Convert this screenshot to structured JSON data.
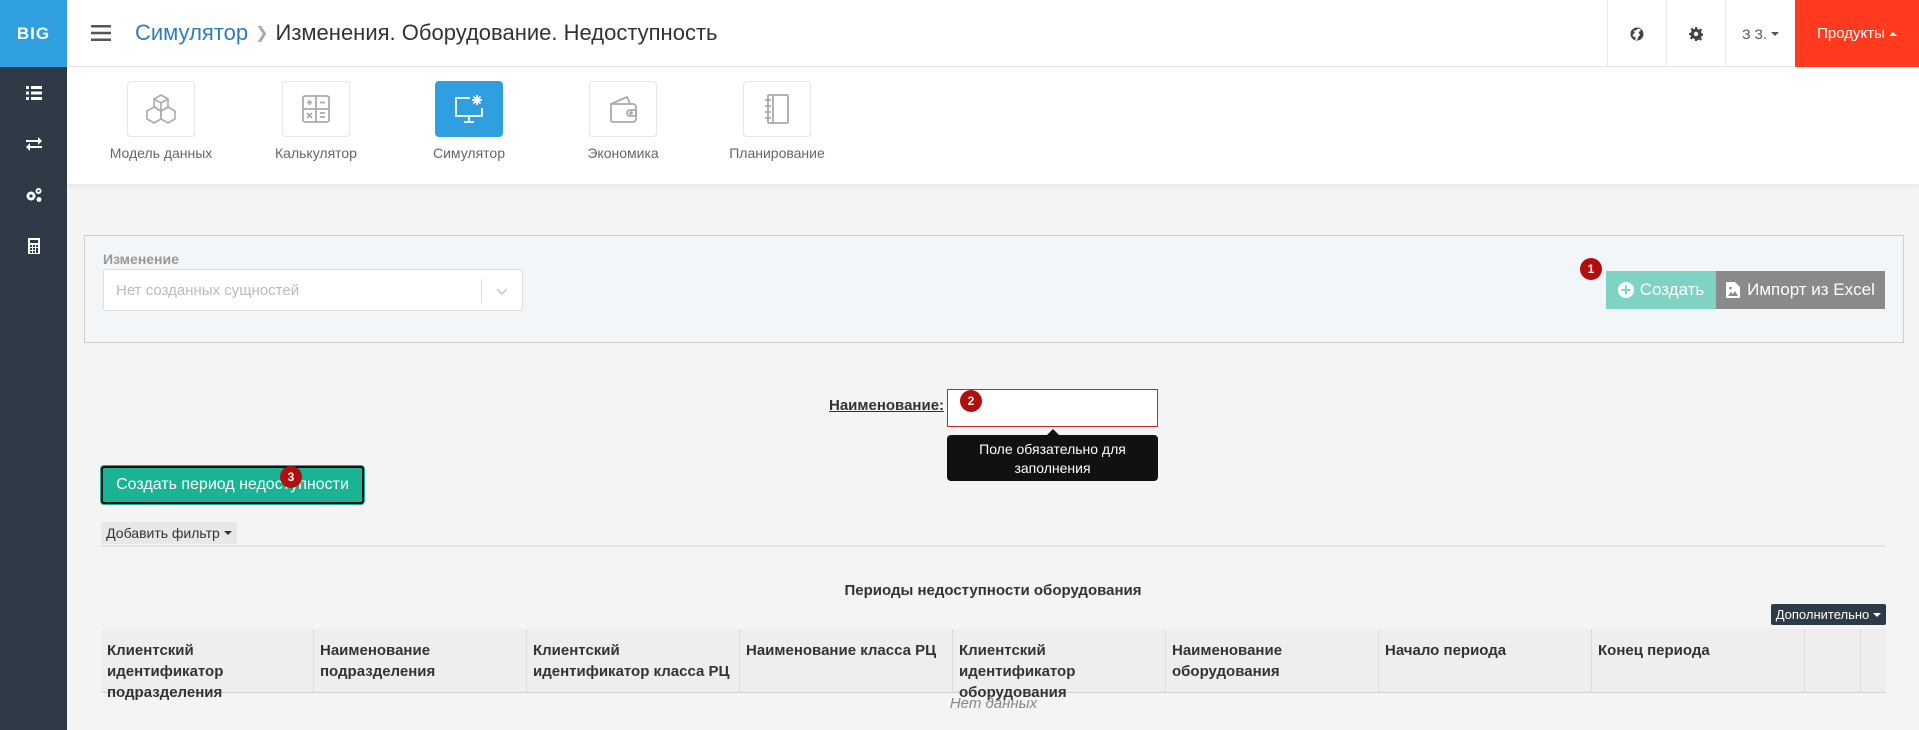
{
  "sidebar": {
    "logo": "BIG",
    "items": [
      {
        "icon": "list-icon"
      },
      {
        "icon": "exchange-icon"
      },
      {
        "icon": "cogs-icon"
      },
      {
        "icon": "calculator-icon"
      }
    ]
  },
  "header": {
    "breadcrumb_link": "Симулятор",
    "breadcrumb_current": "Изменения. Оборудование. Недоступность",
    "user_label": "З З.",
    "products_label": "Продукты"
  },
  "modules": [
    {
      "label": "Модель данных",
      "icon": "cubes-icon"
    },
    {
      "label": "Калькулятор",
      "icon": "calculator-icon"
    },
    {
      "label": "Симулятор",
      "icon": "monitor-icon",
      "active": true
    },
    {
      "label": "Экономика",
      "icon": "wallet-icon"
    },
    {
      "label": "Планирование",
      "icon": "notebook-icon"
    }
  ],
  "panel": {
    "label": "Изменение",
    "select_placeholder": "Нет созданных сущностей",
    "create_label": "Создать",
    "import_label": "Импорт из Excel"
  },
  "badges": {
    "b1": "1",
    "b2": "2",
    "b3": "3"
  },
  "form": {
    "name_label": "Наименование:",
    "name_value": "",
    "tooltip_line1": "Поле обязательно для",
    "tooltip_line2": "заполнения"
  },
  "actions": {
    "create_period_label": "Создать период недоступности",
    "add_filter_label": "Добавить фильтр"
  },
  "table": {
    "title": "Периоды недоступности оборудования",
    "more_label": "Дополнительно",
    "columns": [
      "Клиентский идентификатор подразделения",
      "Наименование подразделения",
      "Клиентский идентификатор класса РЦ",
      "Наименование класса РЦ",
      "Клиентский идентификатор оборудования",
      "Наименование оборудования",
      "Начало периода",
      "Конец периода"
    ],
    "empty_text": "Нет данных"
  },
  "colors": {
    "brand_blue": "#2f9fe0",
    "sidebar": "#2e3a46",
    "products_red": "#ff3a1f",
    "primary_green": "#1ab394",
    "badge_red": "#b40d0d"
  }
}
